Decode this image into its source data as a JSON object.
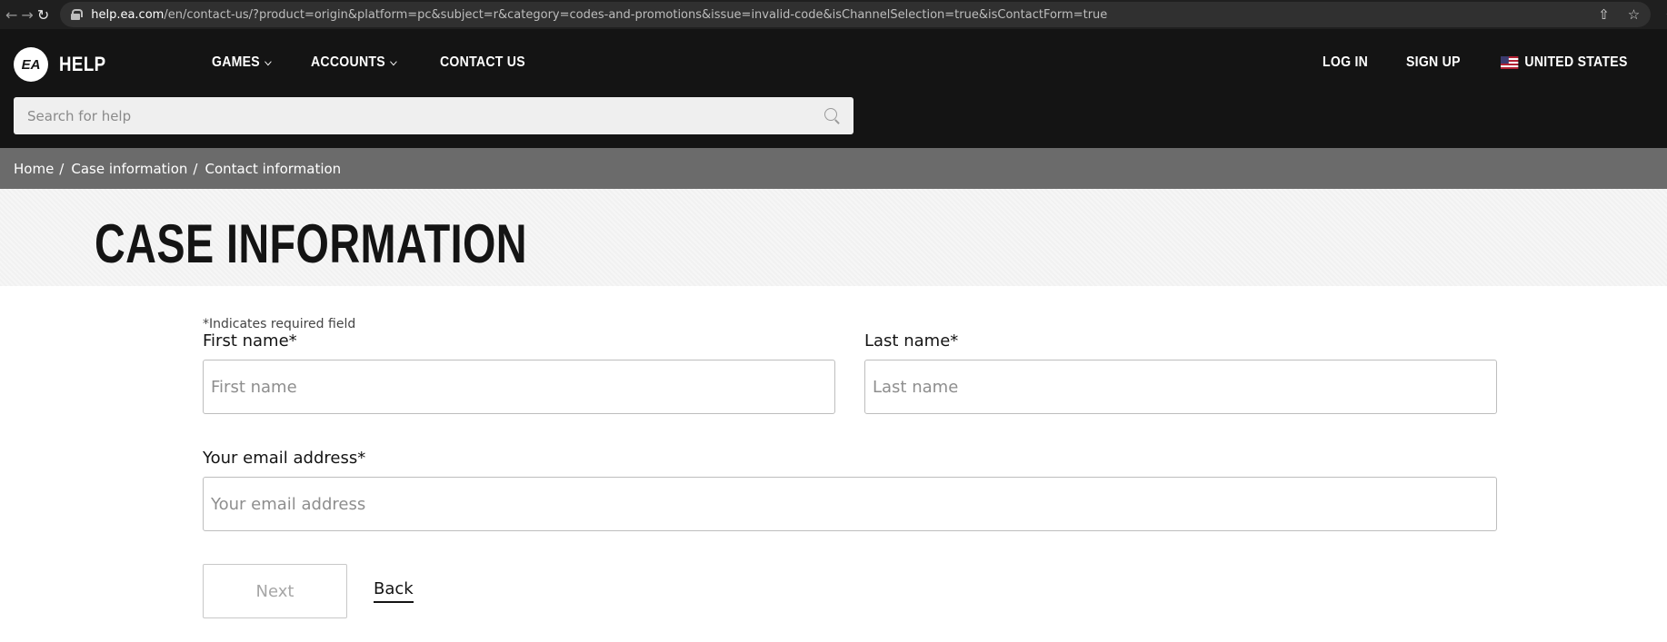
{
  "browser": {
    "url_host": "help.ea.com",
    "url_rest": "/en/contact-us/?product=origin&platform=pc&subject=r&category=codes-and-promotions&issue=invalid-code&isChannelSelection=true&isContactForm=true"
  },
  "header": {
    "logo_text": "EA",
    "brand": "HELP",
    "nav": [
      {
        "label": "GAMES"
      },
      {
        "label": "ACCOUNTS"
      },
      {
        "label": "CONTACT US"
      }
    ],
    "login": "LOG IN",
    "signup": "SIGN UP",
    "region": "UNITED STATES",
    "search_placeholder": "Search for help"
  },
  "breadcrumb": [
    "Home",
    "Case information",
    "Contact information"
  ],
  "page": {
    "title": "CASE INFORMATION"
  },
  "form": {
    "required_note": "*Indicates required field",
    "first_name_label": "First name*",
    "first_name_placeholder": "First name",
    "last_name_label": "Last name*",
    "last_name_placeholder": "Last name",
    "email_label": "Your email address*",
    "email_placeholder": "Your email address",
    "next": "Next",
    "back": "Back"
  },
  "colors": {
    "header_bg": "#141414",
    "breadcrumb_bg": "#6b6b6b",
    "text": "#141414"
  }
}
